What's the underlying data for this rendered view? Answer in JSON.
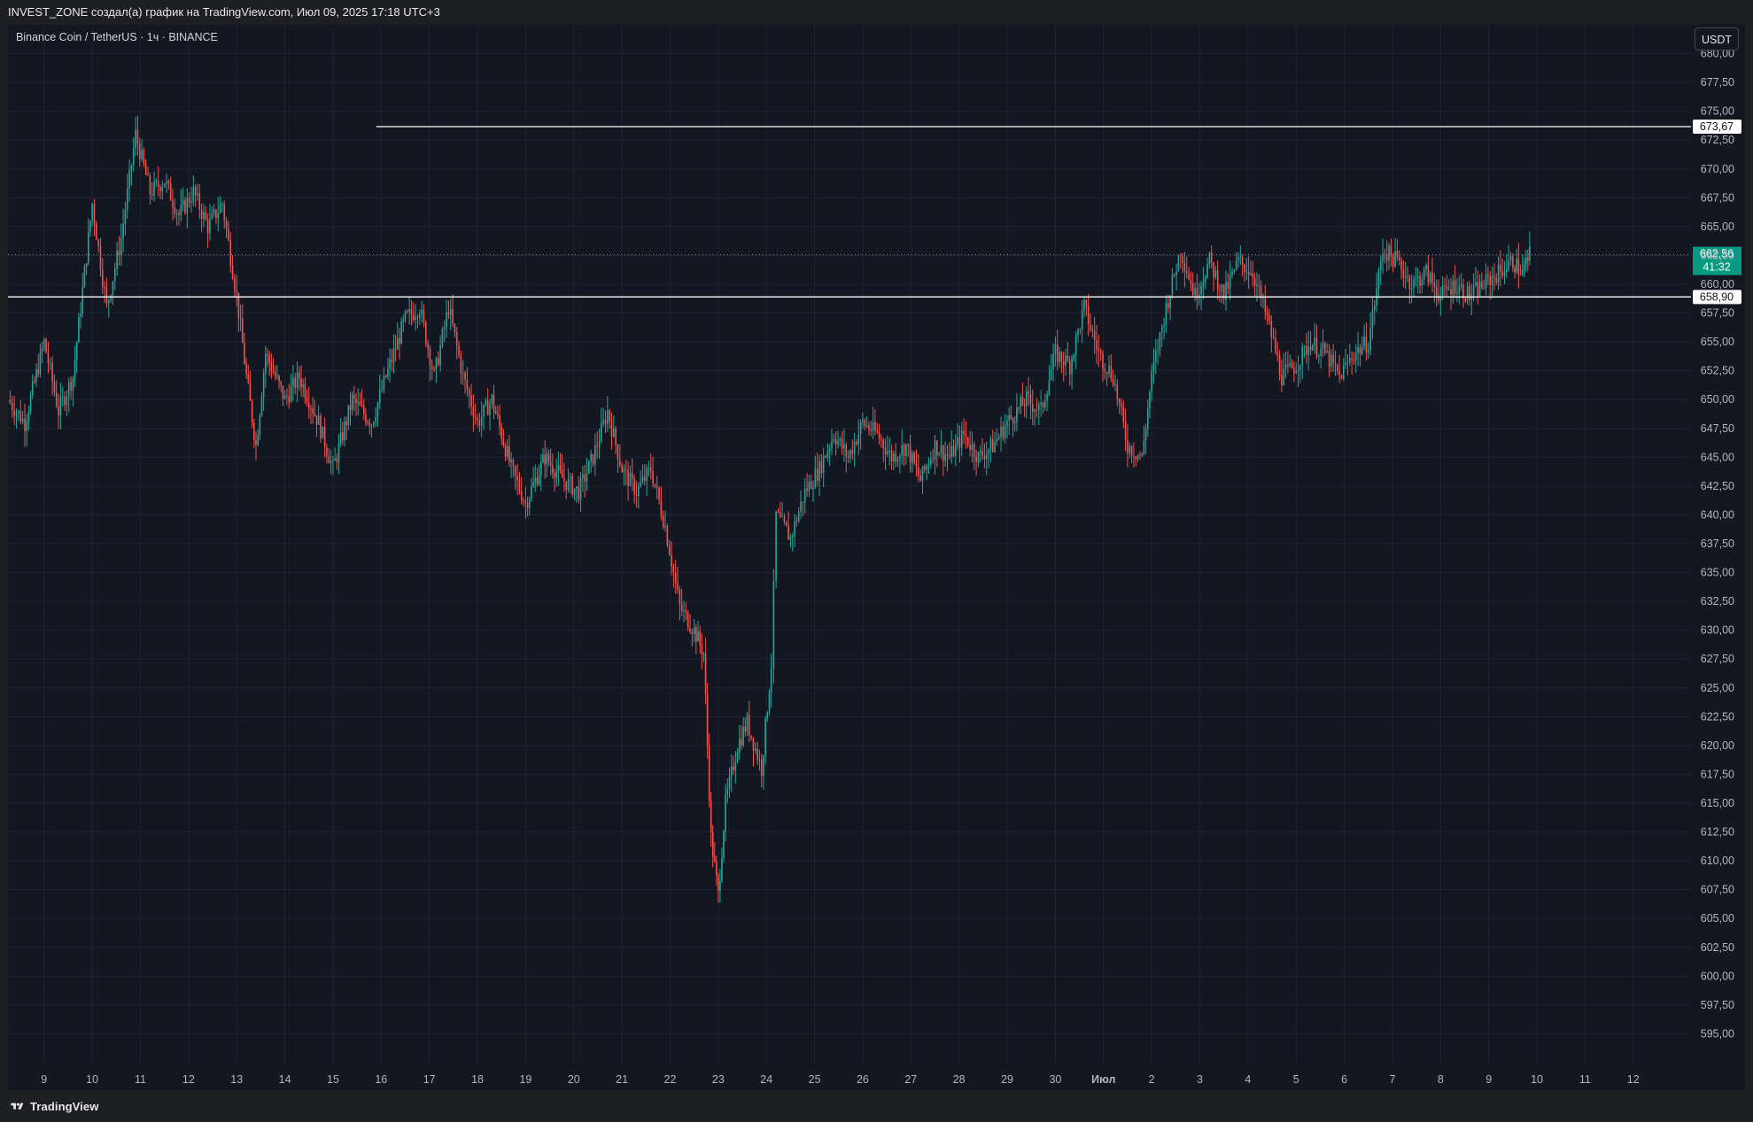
{
  "header": {
    "attribution": "INVEST_ZONE создал(а) график на TradingView.com, Июл 09, 2025 17:18 UTC+3"
  },
  "symbol_info": "Binance Coin / TetherUS · 1ч · BINANCE",
  "currency": "USDT",
  "footer": {
    "brand": "TradingView"
  },
  "colors": {
    "background": "#131722",
    "grid": "#1f2330",
    "up": "#26a69a",
    "down": "#ef5350",
    "level_line": "#ffffff",
    "last_price_bg": "#089981",
    "axis_text": "#b2b5be"
  },
  "chart_data": {
    "type": "candlestick",
    "timeframe": "1ч",
    "y_axis": {
      "min": 592.5,
      "max": 682.5,
      "ticks": [
        "595,00",
        "597,50",
        "600,00",
        "602,50",
        "605,00",
        "607,50",
        "610,00",
        "612,50",
        "615,00",
        "617,50",
        "620,00",
        "622,50",
        "625,00",
        "627,50",
        "630,00",
        "632,50",
        "635,00",
        "637,50",
        "640,00",
        "642,50",
        "645,00",
        "647,50",
        "650,00",
        "652,50",
        "655,00",
        "657,50",
        "660,00",
        "662,50",
        "665,00",
        "667,50",
        "670,00",
        "672,50",
        "675,00",
        "677,50",
        "680,00"
      ],
      "tick_step": 2.5,
      "first_tick": 595
    },
    "x_axis": {
      "ticks": [
        {
          "label": "9",
          "pos": 9
        },
        {
          "label": "10",
          "pos": 10
        },
        {
          "label": "11",
          "pos": 11
        },
        {
          "label": "12",
          "pos": 12
        },
        {
          "label": "13",
          "pos": 13
        },
        {
          "label": "14",
          "pos": 14
        },
        {
          "label": "15",
          "pos": 15
        },
        {
          "label": "16",
          "pos": 16
        },
        {
          "label": "17",
          "pos": 17
        },
        {
          "label": "18",
          "pos": 18
        },
        {
          "label": "19",
          "pos": 19
        },
        {
          "label": "20",
          "pos": 20
        },
        {
          "label": "21",
          "pos": 21
        },
        {
          "label": "22",
          "pos": 22
        },
        {
          "label": "23",
          "pos": 23
        },
        {
          "label": "24",
          "pos": 24
        },
        {
          "label": "25",
          "pos": 25
        },
        {
          "label": "26",
          "pos": 26
        },
        {
          "label": "27",
          "pos": 27
        },
        {
          "label": "28",
          "pos": 28
        },
        {
          "label": "29",
          "pos": 29
        },
        {
          "label": "30",
          "pos": 30
        },
        {
          "label": "Июл",
          "pos": 31
        },
        {
          "label": "2",
          "pos": 32
        },
        {
          "label": "3",
          "pos": 33
        },
        {
          "label": "4",
          "pos": 34
        },
        {
          "label": "5",
          "pos": 35
        },
        {
          "label": "6",
          "pos": 36
        },
        {
          "label": "7",
          "pos": 37
        },
        {
          "label": "8",
          "pos": 38
        },
        {
          "label": "9",
          "pos": 39
        },
        {
          "label": "10",
          "pos": 40
        },
        {
          "label": "11",
          "pos": 41
        },
        {
          "label": "12",
          "pos": 42
        }
      ],
      "min": 8.25,
      "max": 43.2
    },
    "horizontal_levels": [
      {
        "value": 673.67,
        "label": "673,67",
        "from": 15.9
      },
      {
        "value": 658.9,
        "label": "658,90",
        "from": 8.25
      }
    ],
    "last_price": {
      "value": 662.56,
      "label": "662,56",
      "countdown": "41:32"
    },
    "price_path": [
      [
        8.25,
        650
      ],
      [
        8.6,
        648
      ],
      [
        9.0,
        655
      ],
      [
        9.3,
        649
      ],
      [
        9.6,
        652
      ],
      [
        10.0,
        667
      ],
      [
        10.3,
        658
      ],
      [
        10.6,
        664
      ],
      [
        10.9,
        673
      ],
      [
        11.2,
        668
      ],
      [
        11.5,
        669
      ],
      [
        11.8,
        666
      ],
      [
        12.1,
        668
      ],
      [
        12.4,
        665
      ],
      [
        12.7,
        667
      ],
      [
        13.0,
        659
      ],
      [
        13.2,
        652
      ],
      [
        13.4,
        646
      ],
      [
        13.6,
        654
      ],
      [
        14.0,
        650
      ],
      [
        14.3,
        652
      ],
      [
        14.7,
        648
      ],
      [
        15.0,
        644
      ],
      [
        15.4,
        650
      ],
      [
        15.8,
        648
      ],
      [
        16.1,
        652
      ],
      [
        16.5,
        657
      ],
      [
        16.8,
        658
      ],
      [
        17.1,
        652
      ],
      [
        17.4,
        658
      ],
      [
        17.7,
        652
      ],
      [
        18.0,
        648
      ],
      [
        18.3,
        650
      ],
      [
        18.7,
        644
      ],
      [
        19.0,
        641
      ],
      [
        19.4,
        645
      ],
      [
        19.8,
        643
      ],
      [
        20.1,
        642
      ],
      [
        20.4,
        645
      ],
      [
        20.7,
        649
      ],
      [
        21.0,
        644
      ],
      [
        21.3,
        642
      ],
      [
        21.6,
        644
      ],
      [
        21.9,
        639
      ],
      [
        22.2,
        632
      ],
      [
        22.5,
        630
      ],
      [
        22.7,
        628
      ],
      [
        22.85,
        612
      ],
      [
        23.0,
        607
      ],
      [
        23.15,
        615
      ],
      [
        23.4,
        620
      ],
      [
        23.6,
        622
      ],
      [
        23.9,
        618
      ],
      [
        24.1,
        627
      ],
      [
        24.2,
        640
      ],
      [
        24.5,
        638
      ],
      [
        24.8,
        642
      ],
      [
        25.1,
        644
      ],
      [
        25.4,
        647
      ],
      [
        25.7,
        645
      ],
      [
        26.0,
        648
      ],
      [
        26.3,
        647
      ],
      [
        26.6,
        645
      ],
      [
        26.9,
        646
      ],
      [
        27.2,
        643
      ],
      [
        27.5,
        646
      ],
      [
        27.8,
        645
      ],
      [
        28.1,
        647
      ],
      [
        28.4,
        645
      ],
      [
        28.7,
        646
      ],
      [
        29.0,
        648
      ],
      [
        29.4,
        650
      ],
      [
        29.7,
        649
      ],
      [
        30.0,
        654
      ],
      [
        30.3,
        653
      ],
      [
        30.6,
        658
      ],
      [
        30.9,
        654
      ],
      [
        31.2,
        652
      ],
      [
        31.5,
        646
      ],
      [
        31.8,
        645
      ],
      [
        32.0,
        652
      ],
      [
        32.3,
        658
      ],
      [
        32.6,
        663
      ],
      [
        32.9,
        659
      ],
      [
        33.2,
        662
      ],
      [
        33.5,
        659
      ],
      [
        33.8,
        662
      ],
      [
        34.1,
        661
      ],
      [
        34.4,
        657
      ],
      [
        34.7,
        652
      ],
      [
        35.0,
        653
      ],
      [
        35.3,
        655
      ],
      [
        35.6,
        654
      ],
      [
        35.9,
        652
      ],
      [
        36.2,
        654
      ],
      [
        36.5,
        655
      ],
      [
        36.8,
        663
      ],
      [
        37.1,
        662
      ],
      [
        37.4,
        660
      ],
      [
        37.7,
        661
      ],
      [
        38.0,
        659
      ],
      [
        38.3,
        660
      ],
      [
        38.6,
        659
      ],
      [
        38.9,
        660
      ],
      [
        39.2,
        661
      ],
      [
        39.5,
        662
      ],
      [
        39.7,
        661
      ],
      [
        39.85,
        662.6
      ]
    ]
  }
}
